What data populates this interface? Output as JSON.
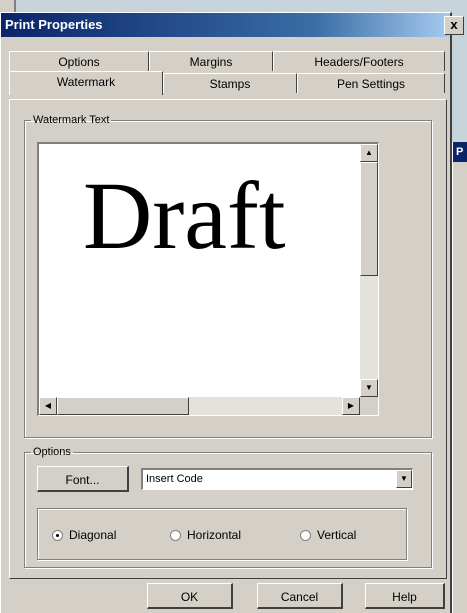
{
  "dialog": {
    "title": "Print Properties",
    "close_glyph": "x"
  },
  "background_window": {
    "title_fragment": "P"
  },
  "tabs": {
    "row1": [
      "Options",
      "Margins",
      "Headers/Footers"
    ],
    "row2": [
      "Watermark",
      "Stamps",
      "Pen Settings"
    ],
    "active": "Watermark"
  },
  "watermark": {
    "legend": "Watermark Text",
    "text": "Draft"
  },
  "options": {
    "legend": "Options",
    "font_button": "Font...",
    "insert_code_value": "Insert Code",
    "orientation": [
      {
        "label": "Diagonal",
        "selected": true
      },
      {
        "label": "Horizontal",
        "selected": false
      },
      {
        "label": "Vertical",
        "selected": false
      }
    ]
  },
  "buttons": {
    "ok": "OK",
    "cancel": "Cancel",
    "help": "Help"
  },
  "icons": {
    "scroll_up": "triangle-up",
    "scroll_down": "triangle-down",
    "scroll_left": "triangle-left",
    "scroll_right": "triangle-right",
    "dropdown": "triangle-down"
  },
  "colors": {
    "titlebar": "#0a246a",
    "face": "#d4d0c8"
  }
}
